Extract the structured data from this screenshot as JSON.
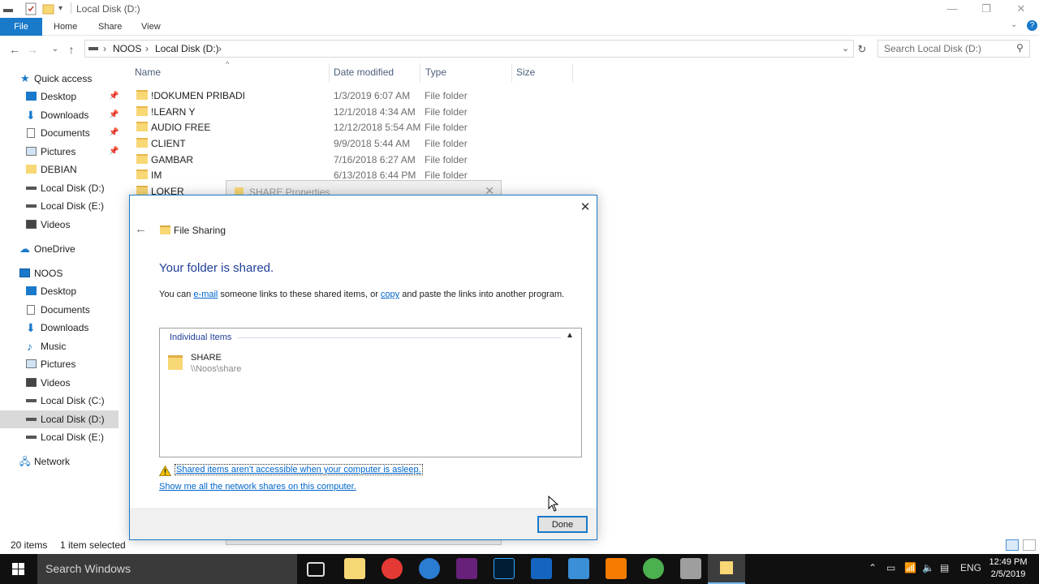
{
  "window": {
    "title": "Local Disk (D:)",
    "minimize": "—",
    "maximize": "❐",
    "close": "✕"
  },
  "ribbon": {
    "tabs": [
      "File",
      "Home",
      "Share",
      "View"
    ]
  },
  "address": {
    "crumbs": [
      "NOOS",
      "Local Disk (D:)"
    ],
    "search_placeholder": "Search Local Disk (D:)"
  },
  "nav": {
    "items": [
      {
        "label": "Quick access",
        "icon": "star-icon"
      },
      {
        "label": "Desktop",
        "icon": "desktop-icon",
        "pinned": true
      },
      {
        "label": "Downloads",
        "icon": "download-icon",
        "pinned": true
      },
      {
        "label": "Documents",
        "icon": "documents-icon",
        "pinned": true
      },
      {
        "label": "Pictures",
        "icon": "pictures-icon",
        "pinned": true
      },
      {
        "label": "DEBIAN",
        "icon": "folder-icon"
      },
      {
        "label": "Local Disk (D:)",
        "icon": "drive-icon"
      },
      {
        "label": "Local Disk (E:)",
        "icon": "drive-icon"
      },
      {
        "label": "Videos",
        "icon": "videos-icon"
      },
      {
        "label": "OneDrive",
        "icon": "cloud-icon"
      },
      {
        "label": "NOOS",
        "icon": "computer-icon"
      },
      {
        "label": "Desktop",
        "icon": "desktop-icon"
      },
      {
        "label": "Documents",
        "icon": "documents-icon"
      },
      {
        "label": "Downloads",
        "icon": "download-icon"
      },
      {
        "label": "Music",
        "icon": "music-icon"
      },
      {
        "label": "Pictures",
        "icon": "pictures-icon"
      },
      {
        "label": "Videos",
        "icon": "videos-icon"
      },
      {
        "label": "Local Disk (C:)",
        "icon": "drive-icon"
      },
      {
        "label": "Local Disk (D:)",
        "icon": "drive-icon",
        "selected": true
      },
      {
        "label": "Local Disk (E:)",
        "icon": "drive-icon"
      },
      {
        "label": "Network",
        "icon": "network-icon"
      }
    ]
  },
  "filelist": {
    "columns": [
      "Name",
      "Date modified",
      "Type",
      "Size"
    ],
    "rows": [
      {
        "name": "!DOKUMEN PRIBADI",
        "date": "1/3/2019 6:07 AM",
        "type": "File folder"
      },
      {
        "name": "!LEARN Y",
        "date": "12/1/2018 4:34 AM",
        "type": "File folder"
      },
      {
        "name": "AUDIO FREE",
        "date": "12/12/2018 5:54 AM",
        "type": "File folder"
      },
      {
        "name": "CLIENT",
        "date": "9/9/2018 5:44 AM",
        "type": "File folder"
      },
      {
        "name": "GAMBAR",
        "date": "7/16/2018 6:27 AM",
        "type": "File folder"
      },
      {
        "name": "IM",
        "date": "6/13/2018 6:44 PM",
        "type": "File folder"
      },
      {
        "name": "LOKER",
        "date": "",
        "type": ""
      }
    ]
  },
  "status": {
    "count": "20 items",
    "selection": "1 item selected"
  },
  "properties_window": {
    "title": "SHARE Properties"
  },
  "dialog": {
    "header_title": "File Sharing",
    "heading": "Your folder is shared.",
    "text_before": "You can ",
    "email_link": "e-mail",
    "text_middle": " someone links to these shared items, or ",
    "copy_link": "copy",
    "text_after": " and paste the links into another program.",
    "group_label": "Individual Items",
    "item_name": "SHARE",
    "item_path": "\\\\Noos\\share",
    "warning_link": "Shared items aren't accessible when your computer is asleep.",
    "network_link": "Show me all the network shares on this computer.",
    "done_label": "Done",
    "close": "✕"
  },
  "taskbar": {
    "search_text": "Search Windows",
    "language": "ENG",
    "time": "12:49 PM",
    "date": "2/5/2019"
  },
  "colors": {
    "accent": "#1979ca",
    "heading_blue": "#1f3e98",
    "link_blue": "#0066cc",
    "folder_yellow": "#f8d775",
    "taskbar_bg": "#101010"
  }
}
